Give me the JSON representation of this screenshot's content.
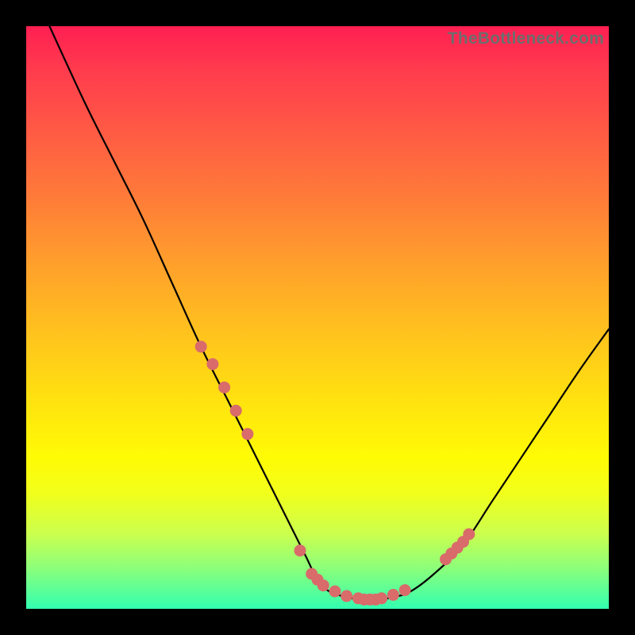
{
  "watermark": "TheBottleneck.com",
  "colors": {
    "frame": "#000000",
    "gradient_top": "#ff1f52",
    "gradient_bottom": "#33ffb0",
    "curve": "#000000",
    "dots": "#d96b6b"
  },
  "chart_data": {
    "type": "line",
    "title": "",
    "xlabel": "",
    "ylabel": "",
    "xlim": [
      0,
      100
    ],
    "ylim": [
      0,
      100
    ],
    "note": "No axis ticks or numeric labels are rendered. Curve values are read as percentage of plot height from bottom (0) to top (100) at sampled x positions; dots clustered where curve nears baseline.",
    "series": [
      {
        "name": "bottleneck-curve",
        "x": [
          4,
          10,
          15,
          20,
          25,
          30,
          35,
          40,
          45,
          48,
          50,
          52,
          55,
          58,
          60,
          63,
          66,
          70,
          75,
          80,
          85,
          90,
          95,
          100
        ],
        "values": [
          100,
          87,
          77,
          67,
          56,
          45,
          35,
          25,
          15,
          9,
          5,
          3,
          2,
          1.5,
          1.5,
          2,
          3,
          6,
          11,
          18.5,
          26,
          33.5,
          41,
          48
        ]
      }
    ],
    "dots": {
      "name": "highlight-dots",
      "x": [
        30,
        32,
        34,
        36,
        38,
        47,
        49,
        50,
        51,
        53,
        55,
        57,
        58,
        59,
        60,
        61,
        63,
        65,
        72,
        73,
        74,
        75,
        76
      ],
      "y": [
        45,
        42,
        38,
        34,
        30,
        10,
        6,
        5,
        4,
        3,
        2.2,
        1.8,
        1.6,
        1.6,
        1.6,
        1.8,
        2.4,
        3.2,
        8.5,
        9.5,
        10.5,
        11.5,
        12.8
      ]
    }
  }
}
